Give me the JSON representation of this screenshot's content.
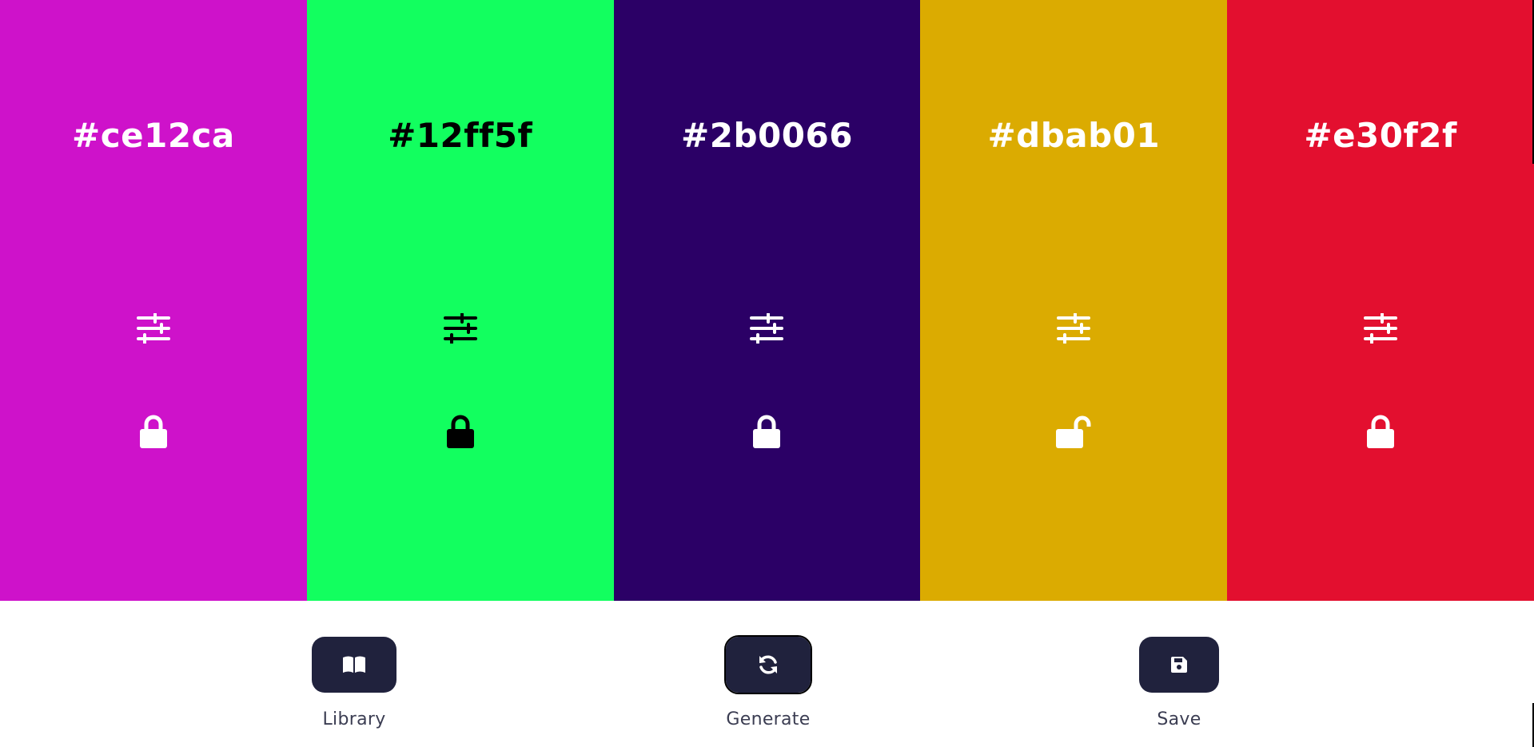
{
  "palette": {
    "swatches": [
      {
        "hex": "#ce12ca",
        "background": "#ce12ca",
        "text_color": "#ffffff",
        "locked": true
      },
      {
        "hex": "#12ff5f",
        "background": "#12ff5f",
        "text_color": "#000000",
        "locked": true
      },
      {
        "hex": "#2b0066",
        "background": "#2b0066",
        "text_color": "#ffffff",
        "locked": true
      },
      {
        "hex": "#dbab01",
        "background": "#dbab01",
        "text_color": "#ffffff",
        "locked": false
      },
      {
        "hex": "#e30f2f",
        "background": "#e30f2f",
        "text_color": "#ffffff",
        "locked": true
      }
    ]
  },
  "icons": {
    "adjust": "sliders-icon",
    "locked": "lock-icon",
    "unlocked": "unlock-icon",
    "library": "book-open-icon",
    "generate": "refresh-icon",
    "save": "floppy-disk-icon"
  },
  "actions": {
    "library_label": "Library",
    "generate_label": "Generate",
    "save_label": "Save"
  },
  "colors": {
    "button_bg": "#20223d",
    "label_color": "#3b3d52"
  }
}
